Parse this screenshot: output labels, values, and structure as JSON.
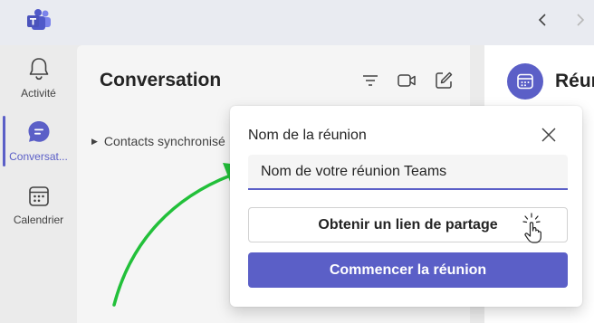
{
  "colors": {
    "accent": "#5b5fc7",
    "arrow": "#22c03a"
  },
  "titlebar": {
    "logo_icon": "teams-logo",
    "back_icon": "chevron-left-icon",
    "forward_icon": "chevron-right-icon"
  },
  "rail": {
    "items": [
      {
        "label": "Activité",
        "icon": "bell-icon"
      },
      {
        "label": "Conversat...",
        "icon": "chat-icon",
        "active": true
      },
      {
        "label": "Calendrier",
        "icon": "calendar-icon"
      }
    ]
  },
  "chatlist": {
    "title": "Conversation",
    "contacts_label": "Contacts synchronisé"
  },
  "rightpane": {
    "title": "Réun"
  },
  "dialog": {
    "title": "Nom de la réunion",
    "name_value": "Nom de votre réunion Teams",
    "share_label": "Obtenir un lien de partage",
    "start_label": "Commencer la réunion"
  }
}
